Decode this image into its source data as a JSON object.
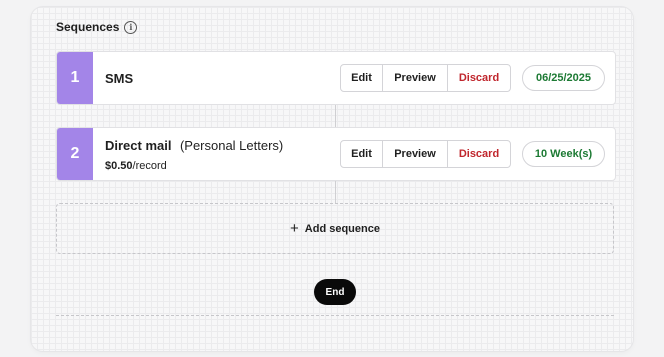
{
  "header": {
    "title": "Sequences",
    "info_icon": "info-icon"
  },
  "sequences": [
    {
      "number": "1",
      "title": "SMS",
      "subtitle": "",
      "price": "",
      "price_unit": "",
      "actions": {
        "edit": "Edit",
        "preview": "Preview",
        "discard": "Discard"
      },
      "pill": "06/25/2025"
    },
    {
      "number": "2",
      "title": "Direct mail",
      "subtitle": "(Personal Letters)",
      "price": "$0.50",
      "price_unit": "/record",
      "actions": {
        "edit": "Edit",
        "preview": "Preview",
        "discard": "Discard"
      },
      "pill": "10 Week(s)"
    }
  ],
  "add_sequence": {
    "icon": "plus-icon",
    "label": "Add sequence"
  },
  "end": {
    "label": "End"
  },
  "colors": {
    "accent_purple": "#a385e8",
    "discard_red": "#c0262d",
    "pill_green": "#1d7a34",
    "end_black": "#0a0a0a"
  }
}
